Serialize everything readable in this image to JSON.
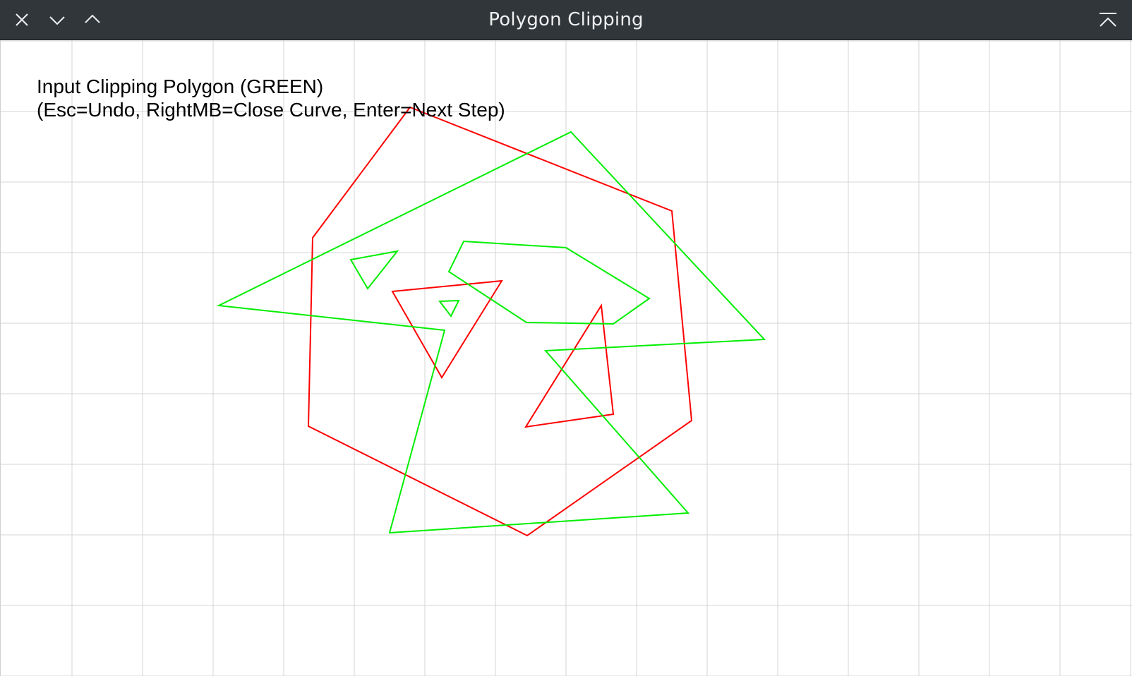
{
  "window": {
    "title": "Polygon Clipping",
    "controls": {
      "close_icon": "close-icon",
      "minimize_icon": "chevron-down-icon",
      "maximize_icon": "chevron-up-icon",
      "keep_above_icon": "keep-above-icon"
    }
  },
  "canvas": {
    "instructions": {
      "line1": "Input Clipping Polygon (GREEN)",
      "line2": "(Esc=Undo, RightMB=Close Curve, Enter=Next Step)"
    },
    "grid": {
      "visible": true,
      "color": "#d4d4d4"
    },
    "colors": {
      "subject": "#ff0000",
      "clip": "#00ee00",
      "background": "#ffffff",
      "titlebar": "#31363b",
      "title_text": "#eff0f1"
    }
  }
}
